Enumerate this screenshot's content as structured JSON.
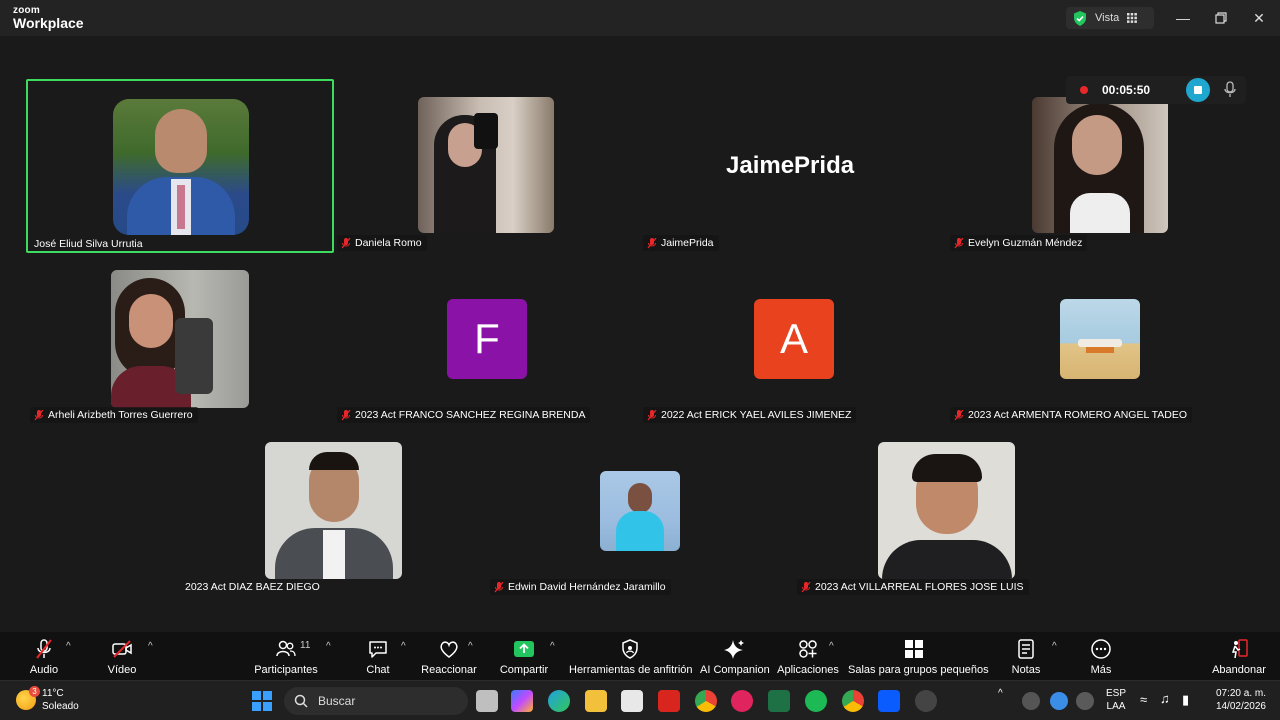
{
  "app": {
    "logo_top": "zoom",
    "logo_bottom": "Workplace",
    "view_label": "Vista"
  },
  "recording": {
    "time": "00:05:50"
  },
  "participants": [
    {
      "name": "José Eliud Silva Urrutia",
      "type": "video",
      "active": true
    },
    {
      "name": "Daniela Romo",
      "type": "video"
    },
    {
      "name": "JaimePrida",
      "type": "name_only",
      "display": "JaimePrida"
    },
    {
      "name": "Evelyn Guzmán Méndez",
      "type": "video"
    },
    {
      "name": "Arheli Arizbeth Torres Guerrero",
      "type": "video"
    },
    {
      "name": "2023 Act FRANCO SANCHEZ REGINA BRENDA",
      "type": "avatar",
      "initial": "F",
      "color": "#8a12a6"
    },
    {
      "name": "2022 Act ERICK YAEL AVILES JIMENEZ",
      "type": "avatar",
      "initial": "A",
      "color": "#e8421f"
    },
    {
      "name": "2023 Act ARMENTA ROMERO ANGEL TADEO",
      "type": "video"
    },
    {
      "name": "2023 Act DIAZ BAEZ DIEGO",
      "type": "video"
    },
    {
      "name": "Edwin David Hernández Jaramillo",
      "type": "video"
    },
    {
      "name": "2023 Act VILLARREAL FLORES JOSE LUIS",
      "type": "video"
    }
  ],
  "toolbar": {
    "audio": "Audio",
    "video": "Vídeo",
    "participants": "Participantes",
    "participants_count": "11",
    "chat": "Chat",
    "react": "Reaccionar",
    "share": "Compartir",
    "host_tools": "Herramientas de anfitrión",
    "ai": "AI Companion",
    "apps": "Aplicaciones",
    "breakout": "Salas para grupos pequeños",
    "notes": "Notas",
    "more": "Más",
    "leave": "Abandonar"
  },
  "taskbar": {
    "temp": "11°C",
    "weather": "Soleado",
    "weather_badge": "3",
    "search_placeholder": "Buscar",
    "lang1": "ESP",
    "lang2": "LAA",
    "time": "07:20 a. m.",
    "date": "14/02/2026"
  },
  "colors": {
    "active_speaker": "#3ddc5e",
    "share_green": "#22c55e",
    "record_red": "#e8272b"
  }
}
